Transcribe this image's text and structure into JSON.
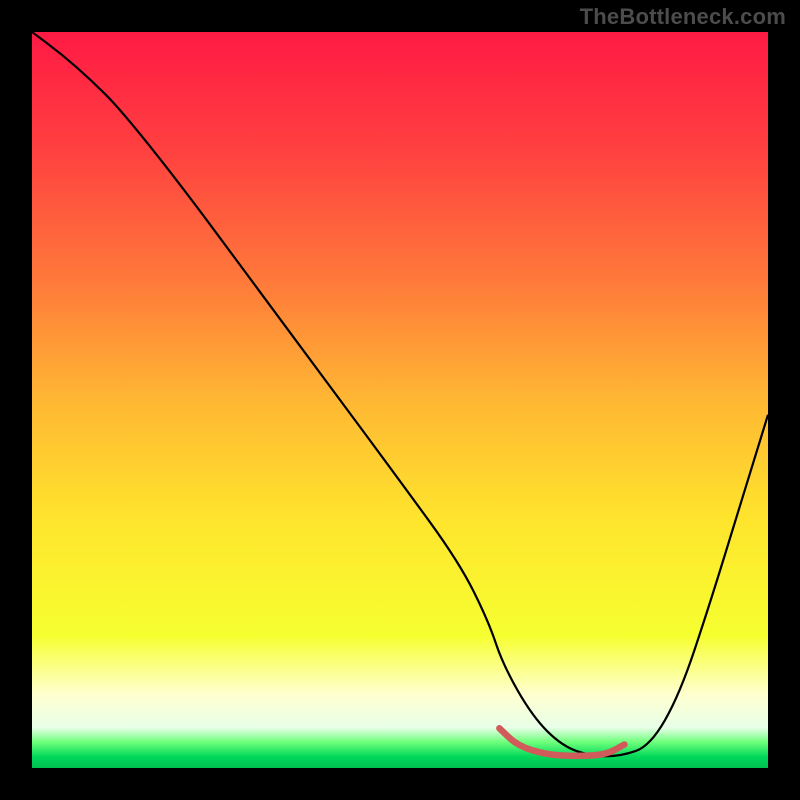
{
  "watermark": "TheBottleneck.com",
  "chart_data": {
    "type": "line",
    "title": "",
    "xlabel": "",
    "ylabel": "",
    "xlim": [
      0,
      100
    ],
    "ylim": [
      0,
      100
    ],
    "background_gradient_stops": [
      {
        "pos": 0.0,
        "color": "#ff1a44"
      },
      {
        "pos": 0.16,
        "color": "#ff4040"
      },
      {
        "pos": 0.34,
        "color": "#ff7a3a"
      },
      {
        "pos": 0.5,
        "color": "#ffb733"
      },
      {
        "pos": 0.66,
        "color": "#ffe42d"
      },
      {
        "pos": 0.82,
        "color": "#f6ff30"
      },
      {
        "pos": 0.9,
        "color": "#ffffd0"
      },
      {
        "pos": 0.945,
        "color": "#e8ffe8"
      },
      {
        "pos": 0.965,
        "color": "#6dff7a"
      },
      {
        "pos": 0.985,
        "color": "#00d85a"
      },
      {
        "pos": 1.0,
        "color": "#00c050"
      }
    ],
    "series": [
      {
        "name": "bottleneck-curve",
        "color": "#000000",
        "width": 2.2,
        "x": [
          0,
          4,
          8,
          12,
          20,
          30,
          40,
          50,
          58,
          62,
          64,
          68,
          72,
          76,
          80,
          84,
          88,
          92,
          96,
          100
        ],
        "y": [
          100,
          97,
          93.5,
          89.5,
          79.5,
          66,
          52.5,
          39,
          28,
          20,
          14,
          7,
          3,
          1.6,
          1.6,
          3,
          10,
          22,
          35,
          48
        ]
      },
      {
        "name": "sweet-spot-band",
        "color": "#d15a5a",
        "width": 6.5,
        "x": [
          63.5,
          66,
          70,
          74,
          78,
          80.5
        ],
        "y": [
          5.4,
          3.0,
          1.8,
          1.6,
          1.8,
          3.2
        ]
      }
    ]
  }
}
